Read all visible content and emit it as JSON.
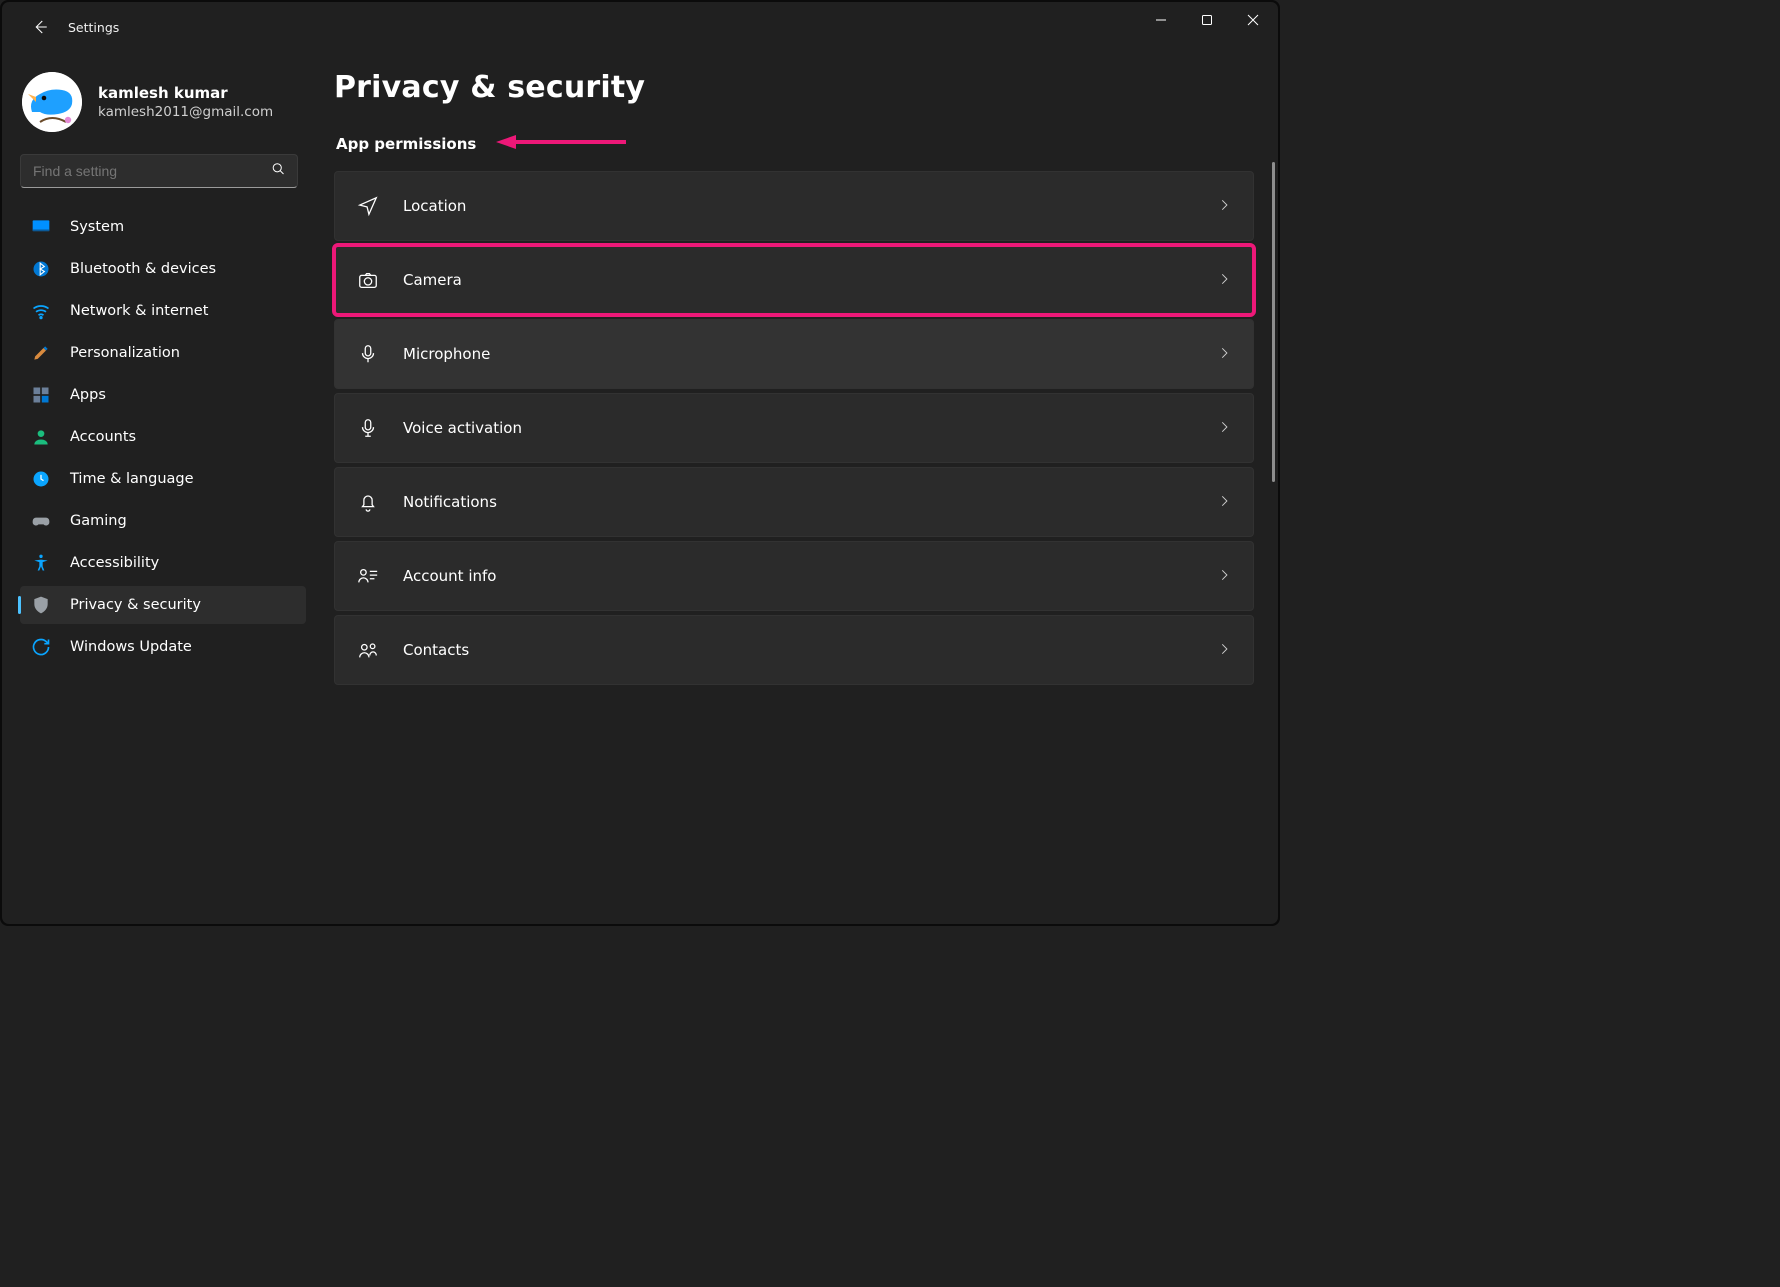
{
  "app": {
    "title": "Settings"
  },
  "user": {
    "name": "kamlesh kumar",
    "email": "kamlesh2011@gmail.com"
  },
  "search": {
    "placeholder": "Find a setting"
  },
  "nav": {
    "items": [
      {
        "key": "system",
        "label": "System"
      },
      {
        "key": "bluetooth",
        "label": "Bluetooth & devices"
      },
      {
        "key": "network",
        "label": "Network & internet"
      },
      {
        "key": "personalization",
        "label": "Personalization"
      },
      {
        "key": "apps",
        "label": "Apps"
      },
      {
        "key": "accounts",
        "label": "Accounts"
      },
      {
        "key": "time",
        "label": "Time & language"
      },
      {
        "key": "gaming",
        "label": "Gaming"
      },
      {
        "key": "accessibility",
        "label": "Accessibility"
      },
      {
        "key": "privacy",
        "label": "Privacy & security"
      },
      {
        "key": "update",
        "label": "Windows Update"
      }
    ],
    "active": "privacy"
  },
  "page": {
    "title": "Privacy & security",
    "section": "App permissions",
    "permissions": [
      {
        "key": "location",
        "label": "Location"
      },
      {
        "key": "camera",
        "label": "Camera",
        "highlight": true
      },
      {
        "key": "microphone",
        "label": "Microphone",
        "hover": true
      },
      {
        "key": "voice",
        "label": "Voice activation"
      },
      {
        "key": "notifications",
        "label": "Notifications"
      },
      {
        "key": "accountinfo",
        "label": "Account info"
      },
      {
        "key": "contacts",
        "label": "Contacts"
      }
    ]
  },
  "annotation": {
    "arrow_color": "#ed1878"
  }
}
